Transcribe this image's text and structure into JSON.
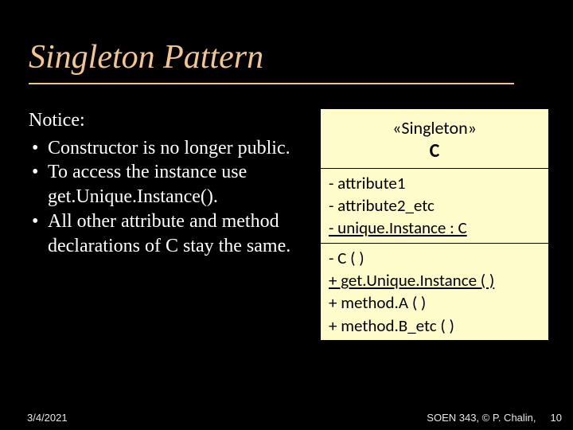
{
  "title": "Singleton Pattern",
  "notice_label": "Notice:",
  "bullets": [
    "Constructor is no longer public.",
    "To access the instance use get.Unique.Instance().",
    "All other attribute and method declarations of C stay the same."
  ],
  "diagram": {
    "stereotype": "«Singleton»",
    "classname": "C",
    "attributes": [
      "- attribute1",
      "- attribute2_etc",
      "- unique.Instance : C"
    ],
    "static_attribute_index": 2,
    "operations": [
      "- C ( )",
      "+ get.Unique.Instance ( )",
      "+ method.A ( )",
      "+ method.B_etc ( )"
    ],
    "static_operation_index": 1
  },
  "footer": {
    "date": "3/4/2021",
    "course": "SOEN 343, © P. Chalin,",
    "page": "10"
  }
}
